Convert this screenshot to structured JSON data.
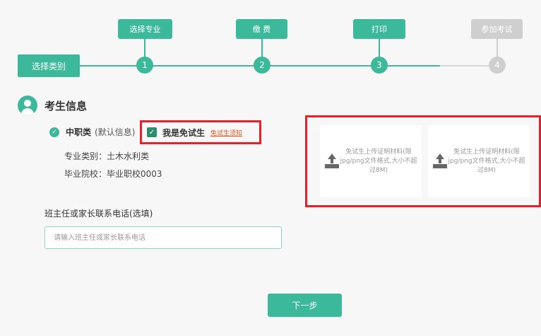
{
  "stepper": {
    "start_label": "选择类别",
    "steps": [
      {
        "label": "选择专业",
        "number": "1",
        "done": true
      },
      {
        "label": "缴 费",
        "number": "2",
        "done": true
      },
      {
        "label": "打印",
        "number": "3",
        "done": true
      },
      {
        "label": "参加考试",
        "number": "4",
        "done": false
      }
    ]
  },
  "section": {
    "title": "考生信息"
  },
  "category": {
    "name": "中职类",
    "default_note": "(默认信息)",
    "exempt_label": "我是免试生",
    "exempt_link": "免试生须知",
    "exempt_checked": true
  },
  "info": {
    "major": "专业类别：土木水利类",
    "school": "毕业院校：毕业职校0003"
  },
  "upload": {
    "card_text": "免试生上传证明材料(限jpg/png文件格式,大小不超过8M)"
  },
  "phone": {
    "label": "班主任或家长联系电话(选填)",
    "placeholder": "请输入班主任或家长联系电话",
    "value": ""
  },
  "next_label": "下一步",
  "colors": {
    "accent": "#3cb89b",
    "inactive": "#cfcfcf",
    "highlight": "#e8202a",
    "link": "#e8561a"
  }
}
